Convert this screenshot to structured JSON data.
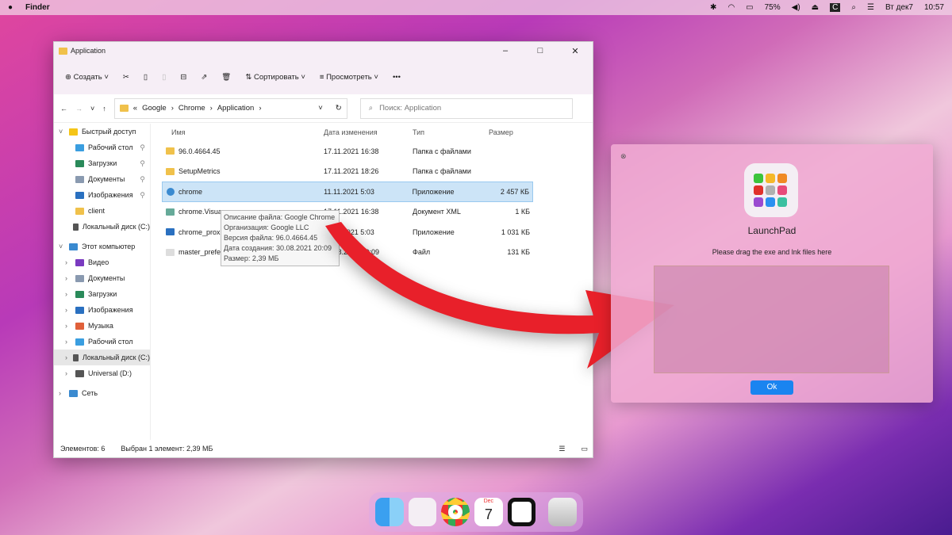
{
  "menubar": {
    "app": "Finder",
    "battery": "75%",
    "date": "Вт дек7",
    "time": "10:57"
  },
  "window": {
    "title": "Application"
  },
  "toolbar": {
    "create": "Создать",
    "sort": "Сортировать",
    "view": "Просмотреть",
    "more": "•••"
  },
  "address": {
    "path": [
      "Google",
      "Chrome",
      "Application"
    ],
    "search_placeholder": "Поиск: Application"
  },
  "sidebar": [
    {
      "label": "Быстрый доступ",
      "level": 0,
      "color": "#f5c518"
    },
    {
      "label": "Рабочий стол",
      "level": 1,
      "color": "#3a9ee0",
      "pin": true
    },
    {
      "label": "Загрузки",
      "level": 1,
      "color": "#2a8a5a",
      "pin": true
    },
    {
      "label": "Документы",
      "level": 1,
      "color": "#8a9ab0",
      "pin": true
    },
    {
      "label": "Изображения",
      "level": 1,
      "color": "#2a70c0",
      "pin": true
    },
    {
      "label": "client",
      "level": 1,
      "color": "#f0c14b"
    },
    {
      "label": "Локальный диск (C:)",
      "level": 1,
      "color": "#555"
    },
    {
      "label": "Этот компьютер",
      "level": 0,
      "color": "#3a8ad0"
    },
    {
      "label": "Видео",
      "level": 1,
      "color": "#7a3ac0"
    },
    {
      "label": "Документы",
      "level": 1,
      "color": "#8a9ab0"
    },
    {
      "label": "Загрузки",
      "level": 1,
      "color": "#2a8a5a"
    },
    {
      "label": "Изображения",
      "level": 1,
      "color": "#2a70c0"
    },
    {
      "label": "Музыка",
      "level": 1,
      "color": "#e0603a"
    },
    {
      "label": "Рабочий стол",
      "level": 1,
      "color": "#3a9ee0"
    },
    {
      "label": "Локальный диск (C:)",
      "level": 1,
      "color": "#555",
      "selected": true
    },
    {
      "label": "Universal (D:)",
      "level": 1,
      "color": "#555"
    },
    {
      "label": "Сеть",
      "level": 0,
      "color": "#3a8ad0"
    }
  ],
  "columns": [
    "Имя",
    "Дата изменения",
    "Тип",
    "Размер"
  ],
  "files": [
    {
      "name": "96.0.4664.45",
      "date": "17.11.2021 16:38",
      "type": "Папка с файлами",
      "size": "",
      "icon": "folder-icon"
    },
    {
      "name": "SetupMetrics",
      "date": "17.11.2021 18:26",
      "type": "Папка с файлами",
      "size": "",
      "icon": "folder-icon"
    },
    {
      "name": "chrome",
      "date": "11.11.2021 5:03",
      "type": "Приложение",
      "size": "2 457 КБ",
      "icon": "chrome-icon",
      "selected": true
    },
    {
      "name": "chrome.Visua",
      "date": "17.11.2021 16:38",
      "type": "Документ XML",
      "size": "1 КБ",
      "icon": "xml-icon"
    },
    {
      "name": "chrome_prox",
      "date": "11.11.2021 5:03",
      "type": "Приложение",
      "size": "1 031 КБ",
      "icon": "app-icon"
    },
    {
      "name": "master_prefe",
      "date": "30.08.2021 20:09",
      "type": "Файл",
      "size": "131 КБ",
      "icon": "file-icon"
    }
  ],
  "tooltip": [
    "Описание файла: Google Chrome",
    "Организация: Google LLC",
    "Версия файла: 96.0.4664.45",
    "Дата создания: 30.08.2021 20:09",
    "Размер: 2,39 МБ"
  ],
  "status": {
    "count": "Элементов: 6",
    "selected": "Выбран 1 элемент: 2,39 МБ"
  },
  "launchpad": {
    "title": "LaunchPad",
    "hint": "Please drag the exe and lnk files here",
    "ok": "Ok",
    "tile_colors": [
      "#3cc43c",
      "#f5b82a",
      "#f08a24",
      "#e0302a",
      "#b0b0b0",
      "#e84a7a",
      "#9a4ad0",
      "#2a90f0",
      "#3ac0a0"
    ]
  },
  "dock": {
    "calendar_month": "Dec",
    "calendar_day": "7"
  },
  "colors": {
    "arrow": "#e8202a",
    "selection": "#cce4f7",
    "ok_button": "#1a84f0"
  }
}
